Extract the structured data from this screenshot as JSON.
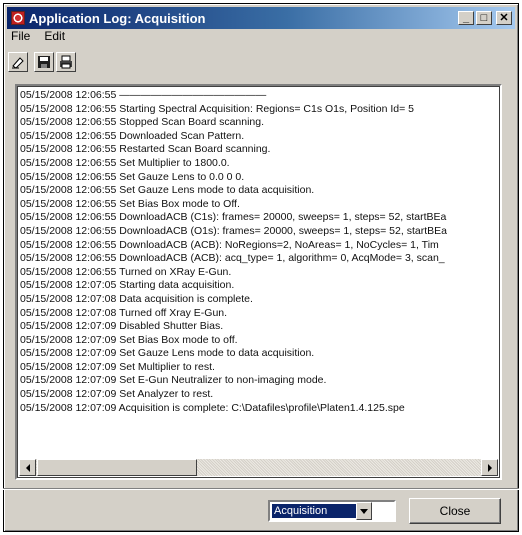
{
  "window": {
    "title": "Application Log: Acquisition",
    "controls": {
      "minimize": "_",
      "maximize": "□",
      "close": "✕"
    }
  },
  "menu": {
    "items": [
      "File",
      "Edit"
    ]
  },
  "toolbar": {
    "icons": [
      "eraser-icon",
      "save-icon",
      "print-icon"
    ]
  },
  "log": {
    "lines": [
      "05/15/2008 12:06:55 ——————————————",
      "05/15/2008 12:06:55 Starting Spectral Acquisition: Regions= C1s O1s, Position Id= 5",
      "05/15/2008 12:06:55 Stopped Scan Board scanning.",
      "05/15/2008 12:06:55 Downloaded Scan Pattern.",
      "05/15/2008 12:06:55 Restarted Scan Board scanning.",
      "05/15/2008 12:06:55 Set Multiplier to 1800.0.",
      "05/15/2008 12:06:55 Set Gauze Lens to 0.0 0 0.",
      "05/15/2008 12:06:55 Set Gauze Lens mode to data acquisition.",
      "05/15/2008 12:06:55 Set Bias Box mode to Off.",
      "05/15/2008 12:06:55 DownloadACB (C1s): frames= 20000, sweeps= 1, steps= 52, startBEa",
      "05/15/2008 12:06:55 DownloadACB (O1s): frames= 20000, sweeps= 1, steps= 52, startBEa",
      "05/15/2008 12:06:55 DownloadACB (ACB): NoRegions=2, NoAreas= 1, NoCycles= 1, Tim",
      "05/15/2008 12:06:55 DownloadACB (ACB): acq_type= 1, algorithm= 0, AcqMode= 3, scan_",
      "05/15/2008 12:06:55 Turned on XRay E-Gun.",
      "05/15/2008 12:07:05 Starting data acquisition.",
      "05/15/2008 12:07:08 Data acquisition is complete.",
      "05/15/2008 12:07:08 Turned off Xray E-Gun.",
      "05/15/2008 12:07:09 Disabled Shutter Bias.",
      "05/15/2008 12:07:09 Set Bias Box mode to off.",
      "05/15/2008 12:07:09 Set Gauze Lens mode to data acquisition.",
      "05/15/2008 12:07:09 Set Multiplier to rest.",
      "05/15/2008 12:07:09 Set E-Gun Neutralizer to non-imaging mode.",
      "05/15/2008 12:07:09 Set Analyzer to rest.",
      "05/15/2008 12:07:09 Acquisition is complete: C:\\Datafiles\\profile\\Platen1.4.125.spe"
    ]
  },
  "footer": {
    "log_select_value": "Acquisition",
    "close_label": "Close"
  }
}
